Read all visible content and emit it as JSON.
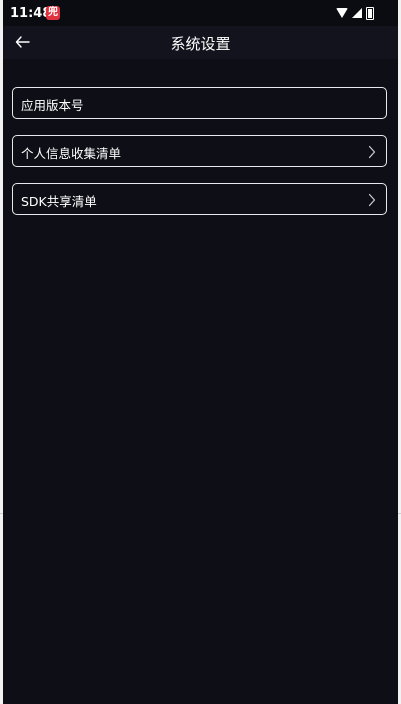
{
  "status_bar": {
    "time": "11:48",
    "notification_icon": "app-notification-icon",
    "notification_glyph": "兜"
  },
  "header": {
    "title": "系统设置",
    "back_icon": "arrow-left-icon"
  },
  "settings": [
    {
      "label": "应用版本号",
      "value": "",
      "has_chevron": false
    },
    {
      "label": "个人信息收集清单",
      "has_chevron": true
    },
    {
      "label": "SDK共享清单",
      "has_chevron": true
    }
  ],
  "colors": {
    "background": "#0e0e17",
    "header": "#13131d",
    "row_border": "#e8e8ee",
    "text": "#ffffff"
  }
}
